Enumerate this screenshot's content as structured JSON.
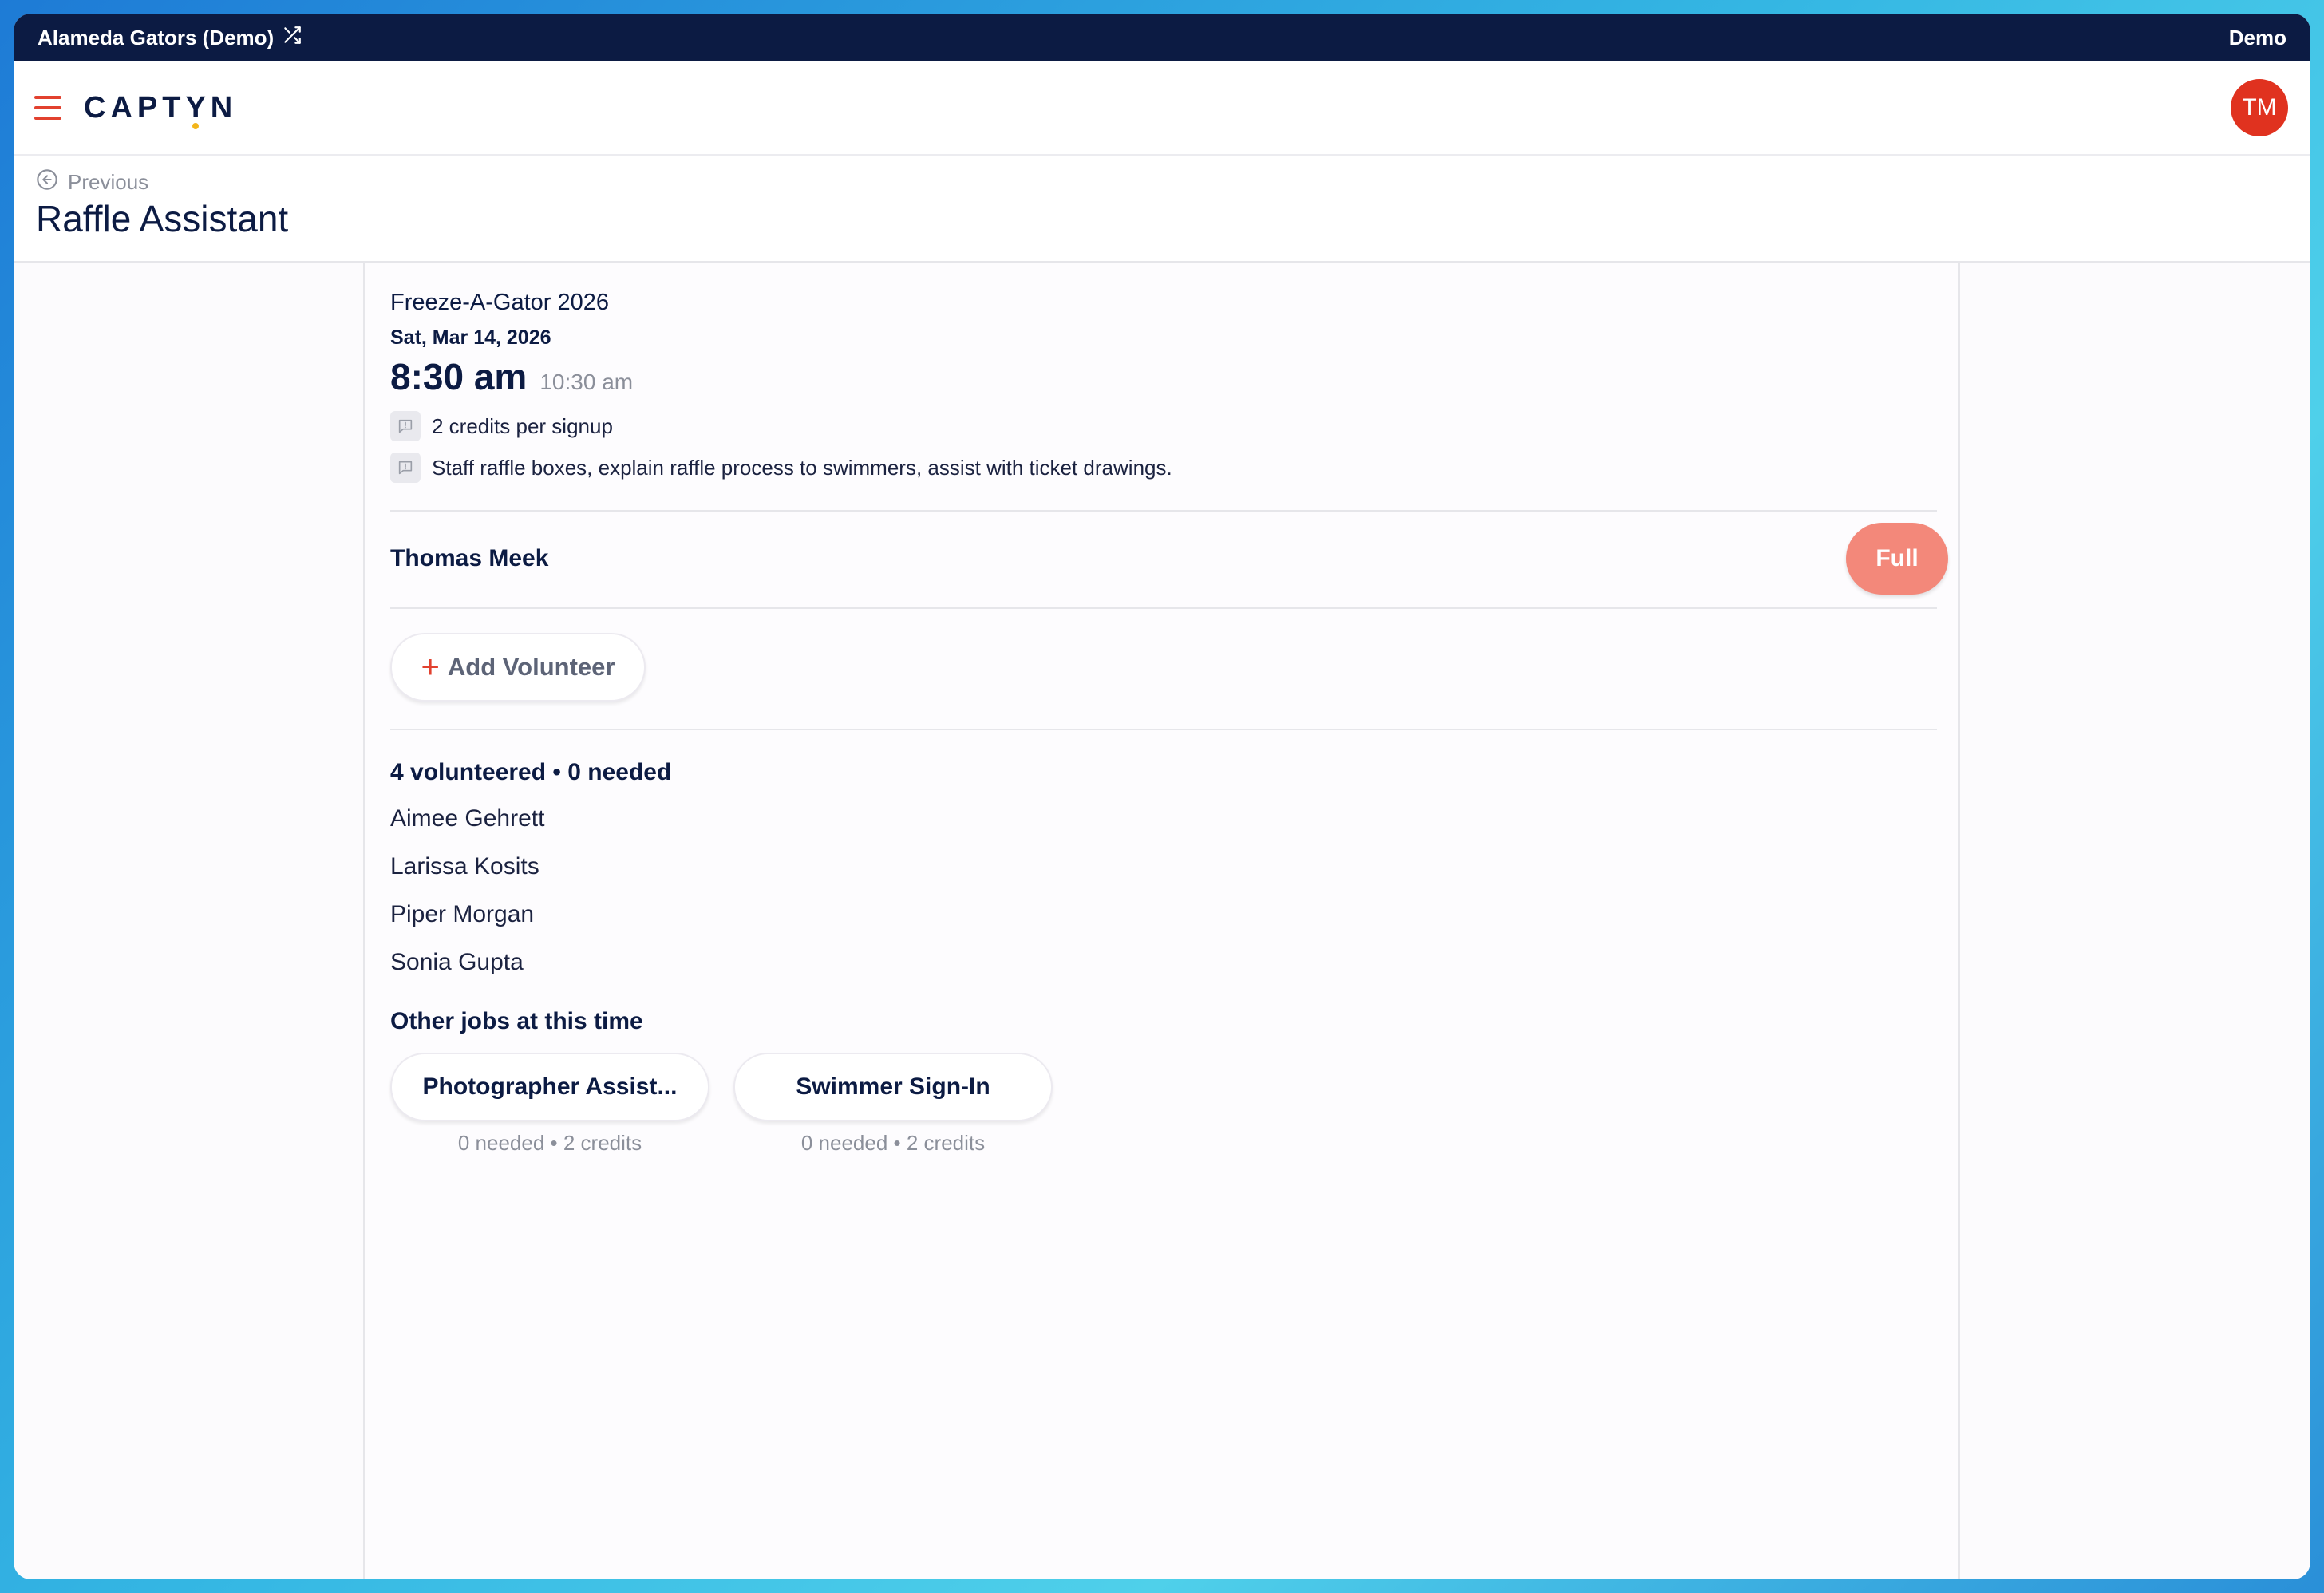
{
  "topbar": {
    "org_name": "Alameda Gators (Demo)",
    "mode_label": "Demo"
  },
  "header": {
    "logo_text": "CAPTYN",
    "avatar_initials": "TM"
  },
  "titlebar": {
    "previous_label": "Previous",
    "page_title": "Raffle Assistant"
  },
  "job": {
    "event_name": "Freeze-A-Gator 2026",
    "date": "Sat, Mar 14, 2026",
    "start_time": "8:30 am",
    "end_time": "10:30 am",
    "credits_info": "2 credits per signup",
    "description": "Staff raffle boxes, explain raffle process to swimmers, assist with ticket drawings.",
    "assignee": "Thomas Meek",
    "full_label": "Full",
    "add_volunteer_label": "Add Volunteer",
    "summary": "4 volunteered • 0 needed",
    "volunteers": [
      "Aimee Gehrett",
      "Larissa Kosits",
      "Piper Morgan",
      "Sonia Gupta"
    ]
  },
  "other_jobs": {
    "heading": "Other jobs at this time",
    "items": [
      {
        "label": "Photographer Assist...",
        "meta": "0 needed • 2 credits"
      },
      {
        "label": "Swimmer Sign-In",
        "meta": "0 needed • 2 credits"
      }
    ]
  },
  "colors": {
    "brand_navy": "#0c1b43",
    "accent_red": "#e2412f",
    "full_badge": "#f3887a"
  }
}
